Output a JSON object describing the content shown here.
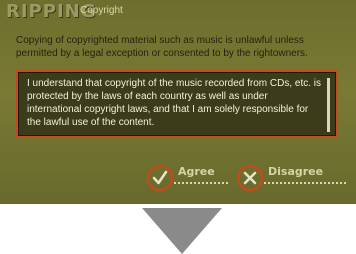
{
  "window": {
    "brand": "RIPPING",
    "title": "Copyright"
  },
  "notice": {
    "intro": "Copying of copyrighted material such as music is unlawful unless permitted by a legal exception or consented to by the rightowners.",
    "agreement_text": "I understand that copyright of the music recorded from CDs, etc. is protected by the laws of each country as well as under international copyright laws, and that I am solely responsible for the lawful use of the content."
  },
  "buttons": {
    "agree": {
      "label": "Agree",
      "icon": "check-icon"
    },
    "disagree": {
      "label": "Disagree",
      "icon": "close-icon"
    }
  },
  "colors": {
    "panel": "#747432",
    "accent": "#c14c1c",
    "arrow": "#8a8a8a"
  }
}
